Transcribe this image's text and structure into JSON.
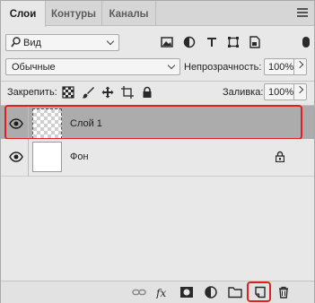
{
  "tabs": [
    {
      "label": "Слои",
      "active": true
    },
    {
      "label": "Контуры",
      "active": false
    },
    {
      "label": "Каналы",
      "active": false
    }
  ],
  "filter": {
    "kind_label": "Вид",
    "icons": [
      "pixel-filter-icon",
      "adjustment-filter-icon",
      "type-filter-icon",
      "shape-filter-icon",
      "smart-object-filter-icon"
    ],
    "toggle": "filter-toggle"
  },
  "blend": {
    "mode": "Обычные",
    "opacity_label": "Непрозрачность:",
    "opacity_value": "100%"
  },
  "lock": {
    "label": "Закрепить:",
    "icons": [
      "lock-transparent-icon",
      "lock-image-icon",
      "lock-position-icon",
      "lock-artboard-icon",
      "lock-all-icon"
    ],
    "fill_label": "Заливка:",
    "fill_value": "100%"
  },
  "layers": [
    {
      "name": "Слой 1",
      "selected": true,
      "visible": true,
      "locked": false,
      "thumb": "transparent"
    },
    {
      "name": "Фон",
      "selected": false,
      "visible": true,
      "locked": true,
      "thumb": "white"
    }
  ],
  "bottom_icons": [
    "link-layers-icon",
    "fx-icon",
    "mask-icon",
    "adjustment-layer-icon",
    "folder-icon",
    "new-layer-icon",
    "trash-icon"
  ],
  "colors": {
    "panel": "#e8e8e8",
    "selected_layer": "#acacac",
    "highlight": "#e02020"
  }
}
